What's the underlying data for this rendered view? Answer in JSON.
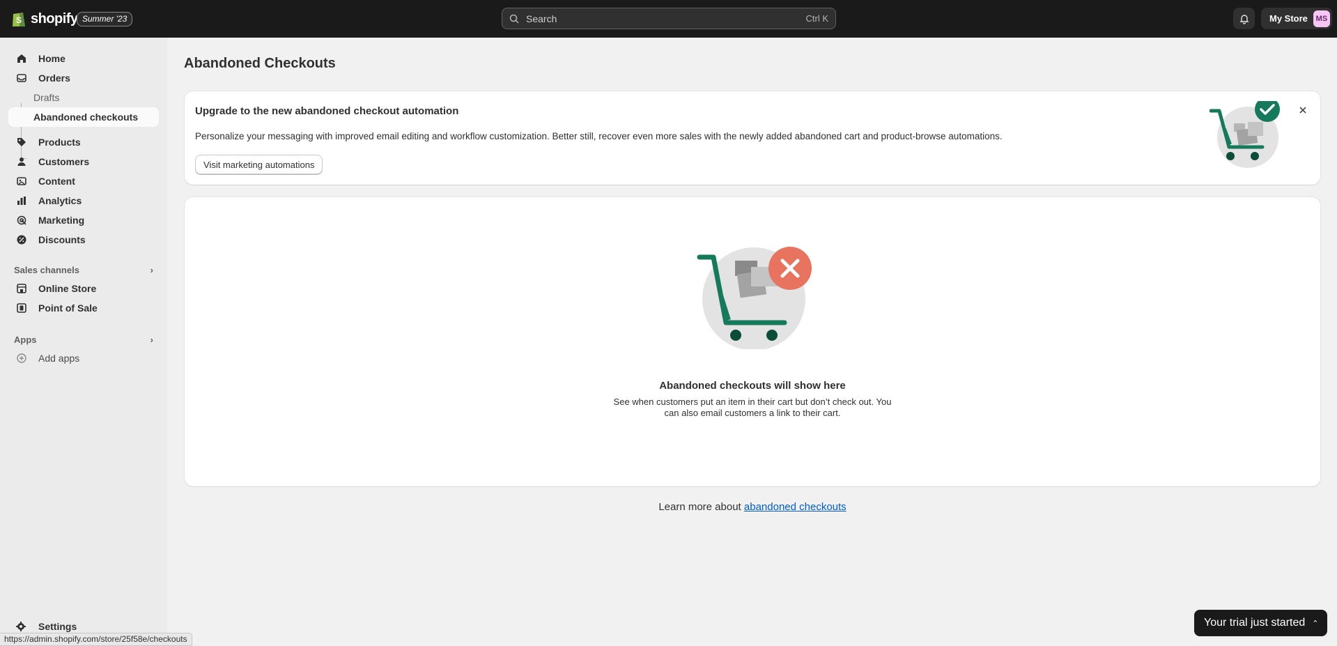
{
  "topbar": {
    "brand": "shopify",
    "edition": "Summer '23",
    "search": {
      "placeholder": "Search",
      "shortcut": "Ctrl K"
    },
    "store_name": "My Store",
    "avatar_initials": "MS"
  },
  "sidebar": {
    "items": [
      {
        "label": "Home",
        "icon": "home-icon"
      },
      {
        "label": "Orders",
        "icon": "orders-icon"
      },
      {
        "label": "Drafts"
      },
      {
        "label": "Abandoned checkouts"
      },
      {
        "label": "Products",
        "icon": "tag-icon"
      },
      {
        "label": "Customers",
        "icon": "person-icon"
      },
      {
        "label": "Content",
        "icon": "image-icon"
      },
      {
        "label": "Analytics",
        "icon": "bar-chart-icon"
      },
      {
        "label": "Marketing",
        "icon": "target-icon"
      },
      {
        "label": "Discounts",
        "icon": "discount-icon"
      }
    ],
    "sales_channels": {
      "heading": "Sales channels",
      "items": [
        {
          "label": "Online Store",
          "icon": "store-icon"
        },
        {
          "label": "Point of Sale",
          "icon": "pos-icon"
        }
      ]
    },
    "apps": {
      "heading": "Apps",
      "items": [
        {
          "label": "Add apps",
          "icon": "plus-circle-icon"
        }
      ]
    },
    "settings": {
      "label": "Settings",
      "icon": "gear-icon"
    }
  },
  "page": {
    "title": "Abandoned Checkouts",
    "banner": {
      "title": "Upgrade to the new abandoned checkout automation",
      "text": "Personalize your messaging with improved email editing and workflow customization. Better still, recover even more sales with the newly added abandoned cart and product-browse automations.",
      "button": "Visit marketing automations"
    },
    "empty_state": {
      "title": "Abandoned checkouts will show here",
      "text": "See when customers put an item in their cart but don’t check out. You can also email customers a link to their cart."
    },
    "learn_more": {
      "prefix": "Learn more about ",
      "link": "abandoned checkouts"
    }
  },
  "trial": {
    "label": "Your trial just started"
  },
  "status_url": "https://admin.shopify.com/store/25f58e/checkouts",
  "colors": {
    "accent_green": "#157a5b",
    "error_red": "#e8735f",
    "link": "#005bd3"
  }
}
